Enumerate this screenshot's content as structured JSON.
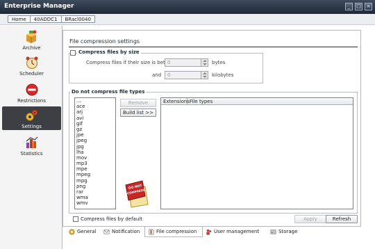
{
  "window": {
    "title": "Enterprise Manager",
    "buttons": {
      "minimize": "_",
      "maximize": "□",
      "close": "×"
    }
  },
  "breadcrumb": [
    "Home",
    "40ADDC1",
    "BRacl0040"
  ],
  "sidebar": {
    "items": [
      {
        "label": "Archive",
        "icon": "archive-icon"
      },
      {
        "label": "Scheduler",
        "icon": "scheduler-icon"
      },
      {
        "label": "Restrictions",
        "icon": "restrictions-icon"
      },
      {
        "label": "Settings",
        "icon": "settings-icon",
        "active": true
      },
      {
        "label": "Statistics",
        "icon": "statistics-icon"
      }
    ]
  },
  "panel": {
    "title": "File compression settings",
    "compress_by_size": {
      "label": "Compress files by size",
      "checked": false,
      "between_label": "Compress files if their size is between",
      "min_value": "0",
      "min_unit": "bytes",
      "and_label": "and",
      "max_value": "0",
      "max_unit": "kilobytes"
    },
    "no_compress": {
      "label": "Do not compress file types",
      "types": [
        "...",
        "ace",
        "arj",
        "avi",
        "gif",
        "gz",
        "jpe",
        "jpeg",
        "jpg",
        "lha",
        "mov",
        "mp3",
        "mpe",
        "mpeg",
        "mpg",
        "png",
        "rar",
        "wma",
        "wmv"
      ],
      "remove_button": "Remove",
      "build_list_button": "Build list >>",
      "columns": [
        "Extensions",
        "File types"
      ],
      "badge_text": "DO NOT COMPRESS"
    },
    "compress_by_default_label": "Compress files by default",
    "apply_button": "Apply",
    "refresh_button": "Refresh"
  },
  "tabs": [
    {
      "label": "General",
      "icon": "general-icon"
    },
    {
      "label": "Notification",
      "icon": "notification-icon"
    },
    {
      "label": "File compression",
      "icon": "file-compression-icon",
      "active": true
    },
    {
      "label": "User management",
      "icon": "user-management-icon"
    },
    {
      "label": "Storage",
      "icon": "storage-icon"
    }
  ]
}
